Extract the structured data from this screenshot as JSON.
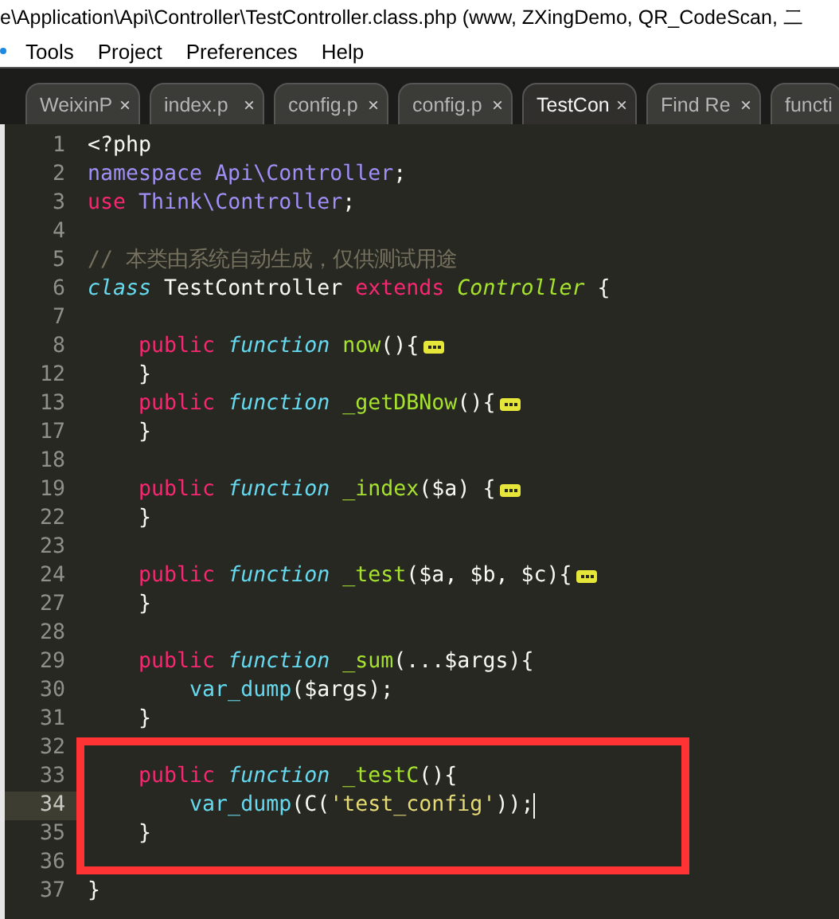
{
  "window": {
    "title": "e\\Application\\Api\\Controller\\TestController.class.php (www, ZXingDemo, QR_CodeScan, 二"
  },
  "menu": [
    "Tools",
    "Project",
    "Preferences",
    "Help"
  ],
  "tabs": [
    {
      "label": "WeixinP",
      "selected": false,
      "closable": true
    },
    {
      "label": "index.p",
      "selected": false,
      "closable": true
    },
    {
      "label": "config.p",
      "selected": false,
      "closable": true
    },
    {
      "label": "config.p",
      "selected": false,
      "closable": true
    },
    {
      "label": "TestCon",
      "selected": true,
      "closable": true
    },
    {
      "label": "Find Re",
      "selected": false,
      "closable": true
    },
    {
      "label": "functi",
      "selected": false,
      "closable": false
    }
  ],
  "close_glyph": "×",
  "code_lines": [
    {
      "number": "1",
      "current": false,
      "folded": false,
      "boxed": false,
      "tokens": [
        {
          "plain": "<?php"
        }
      ]
    },
    {
      "number": "2",
      "current": false,
      "folded": false,
      "boxed": false,
      "tokens": [
        {
          "ns": "namespace Api\\Controller"
        },
        {
          "plain": ";"
        }
      ]
    },
    {
      "number": "3",
      "current": false,
      "folded": false,
      "boxed": false,
      "tokens": [
        {
          "keyword": "use"
        },
        {
          "ns": " Think\\Controller"
        },
        {
          "plain": ";"
        }
      ]
    },
    {
      "number": "4",
      "current": false,
      "folded": false,
      "boxed": false
    },
    {
      "number": "5",
      "current": false,
      "folded": false,
      "boxed": false,
      "tokens": [
        {
          "comment": "// 本类由系统自动生成，仅供测试用途"
        }
      ]
    },
    {
      "number": "6",
      "current": false,
      "folded": false,
      "boxed": false,
      "tokens": [
        {
          "storage": "class"
        },
        {
          "plain": " TestController "
        },
        {
          "keyword": "extends"
        },
        {
          "inherit": " Controller"
        },
        {
          "plain": " {"
        }
      ]
    },
    {
      "number": "7",
      "current": false,
      "folded": false,
      "boxed": false
    },
    {
      "number": "8",
      "current": false,
      "folded": true,
      "boxed": false,
      "tokens": [
        {
          "keyword": "    public"
        },
        {
          "storage": " function"
        },
        {
          "entity": " now"
        },
        {
          "plain": "(){"
        }
      ]
    },
    {
      "number": "12",
      "current": false,
      "folded": false,
      "boxed": false,
      "tokens": [
        {
          "plain": "    }"
        }
      ]
    },
    {
      "number": "13",
      "current": false,
      "folded": true,
      "boxed": false,
      "tokens": [
        {
          "keyword": "    public"
        },
        {
          "storage": " function"
        },
        {
          "entity": " _getDBNow"
        },
        {
          "plain": "(){"
        }
      ]
    },
    {
      "number": "17",
      "current": false,
      "folded": false,
      "boxed": false,
      "tokens": [
        {
          "plain": "    }"
        }
      ]
    },
    {
      "number": "18",
      "current": false,
      "folded": false,
      "boxed": false
    },
    {
      "number": "19",
      "current": false,
      "folded": true,
      "boxed": false,
      "tokens": [
        {
          "keyword": "    public"
        },
        {
          "storage": " function"
        },
        {
          "entity": " _index"
        },
        {
          "plain": "($a) {"
        }
      ]
    },
    {
      "number": "22",
      "current": false,
      "folded": false,
      "boxed": false,
      "tokens": [
        {
          "plain": "    }"
        }
      ]
    },
    {
      "number": "23",
      "current": false,
      "folded": false,
      "boxed": false
    },
    {
      "number": "24",
      "current": false,
      "folded": true,
      "boxed": false,
      "tokens": [
        {
          "keyword": "    public"
        },
        {
          "storage": " function"
        },
        {
          "entity": " _test"
        },
        {
          "plain": "($a, $b, $c){"
        }
      ]
    },
    {
      "number": "27",
      "current": false,
      "folded": false,
      "boxed": false,
      "tokens": [
        {
          "plain": "    }"
        }
      ]
    },
    {
      "number": "28",
      "current": false,
      "folded": false,
      "boxed": false
    },
    {
      "number": "29",
      "current": false,
      "folded": false,
      "boxed": false,
      "tokens": [
        {
          "keyword": "    public"
        },
        {
          "storage": " function"
        },
        {
          "entity": " _sum"
        },
        {
          "plain": "(...$args){"
        }
      ]
    },
    {
      "number": "30",
      "current": false,
      "folded": false,
      "boxed": false,
      "tokens": [
        {
          "support": "        var_dump"
        },
        {
          "plain": "($args);"
        }
      ]
    },
    {
      "number": "31",
      "current": false,
      "folded": false,
      "boxed": false,
      "tokens": [
        {
          "plain": "    }"
        }
      ]
    },
    {
      "number": "32",
      "current": false,
      "folded": false,
      "boxed": true
    },
    {
      "number": "33",
      "current": false,
      "folded": false,
      "boxed": true,
      "tokens": [
        {
          "keyword": "    public"
        },
        {
          "storage": " function"
        },
        {
          "entity": " _testC"
        },
        {
          "plain": "(){"
        }
      ]
    },
    {
      "number": "34",
      "current": true,
      "folded": false,
      "boxed": true,
      "tokens": [
        {
          "support": "        var_dump"
        },
        {
          "plain": "(C("
        },
        {
          "string": "'test_config'"
        },
        {
          "plain": "));"
        }
      ]
    },
    {
      "number": "35",
      "current": false,
      "folded": false,
      "boxed": true,
      "tokens": [
        {
          "plain": "    }"
        }
      ]
    },
    {
      "number": "36",
      "current": false,
      "folded": false,
      "boxed": true
    },
    {
      "number": "37",
      "current": false,
      "folded": false,
      "boxed": false,
      "tokens": [
        {
          "plain": "}"
        }
      ]
    }
  ]
}
